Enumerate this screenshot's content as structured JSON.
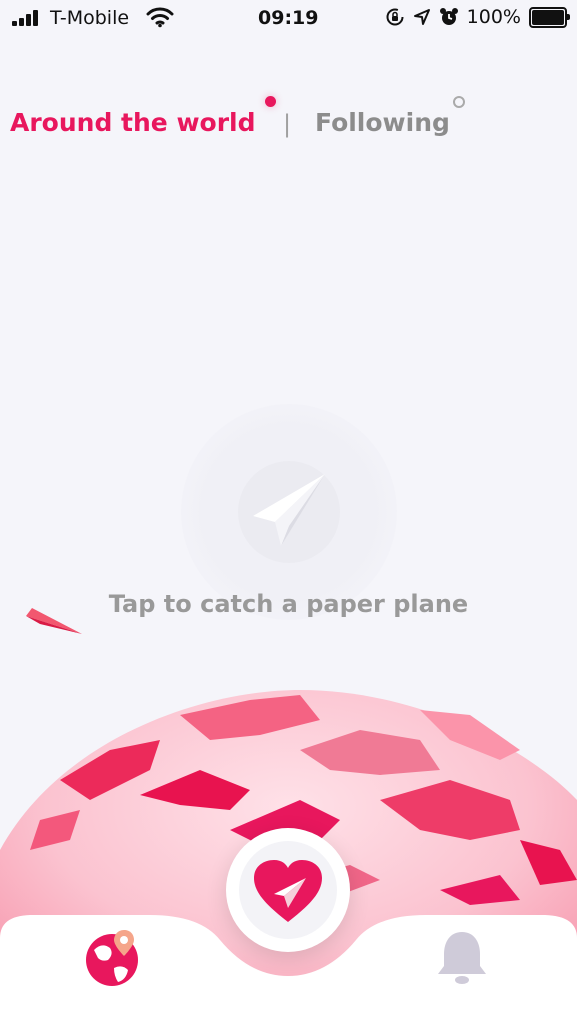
{
  "status": {
    "carrier": "T-Mobile",
    "time": "09:19",
    "battery_percent": "100%",
    "icons": [
      "cellular-signal-icon",
      "wifi-icon",
      "orientation-lock-icon",
      "location-arrow-icon",
      "alarm-icon",
      "battery-icon"
    ]
  },
  "tabs": [
    {
      "label": "Around the world",
      "active": true
    },
    {
      "label": "Following",
      "active": false
    }
  ],
  "tab_separator": "|",
  "catch": {
    "icon": "paper-plane-icon",
    "label": "Tap to catch a paper plane"
  },
  "bottom_bar": {
    "items": [
      "world-map-icon",
      "heart-plane-icon",
      "bell-icon"
    ]
  },
  "colors": {
    "accent": "#e8175d",
    "background": "#f5f5fa",
    "muted": "#8c8c8c"
  }
}
